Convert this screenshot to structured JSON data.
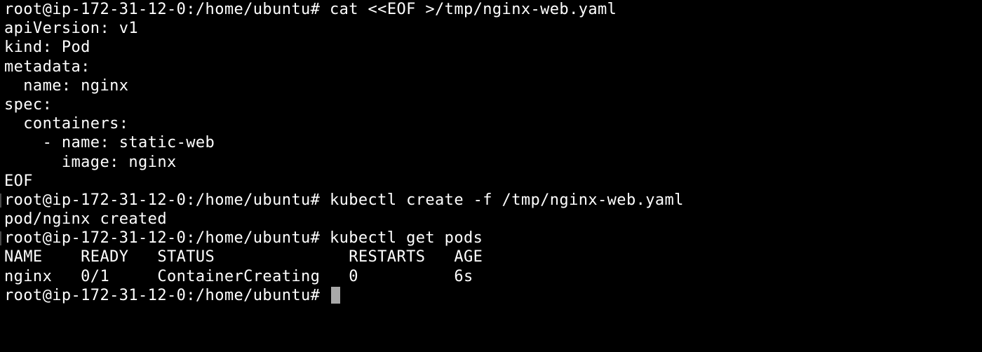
{
  "terminal": {
    "prompt": "root@ip-172-31-12-0:/home/ubuntu#",
    "lines": [
      {
        "prompt": "root@ip-172-31-12-0:/home/ubuntu#",
        "text": " cat <<EOF >/tmp/nginx-web.yaml"
      },
      {
        "prompt": "",
        "text": "apiVersion: v1"
      },
      {
        "prompt": "",
        "text": "kind: Pod"
      },
      {
        "prompt": "",
        "text": "metadata:"
      },
      {
        "prompt": "",
        "text": "  name: nginx"
      },
      {
        "prompt": "",
        "text": "spec:"
      },
      {
        "prompt": "",
        "text": "  containers:"
      },
      {
        "prompt": "",
        "text": "    - name: static-web"
      },
      {
        "prompt": "",
        "text": "      image: nginx"
      },
      {
        "prompt": "",
        "text": "EOF"
      },
      {
        "prompt": "root@ip-172-31-12-0:/home/ubuntu#",
        "text": " kubectl create -f /tmp/nginx-web.yaml"
      },
      {
        "prompt": "",
        "text": "pod/nginx created"
      },
      {
        "prompt": "root@ip-172-31-12-0:/home/ubuntu#",
        "text": " kubectl get pods"
      },
      {
        "prompt": "",
        "text": "NAME    READY   STATUS              RESTARTS   AGE"
      },
      {
        "prompt": "",
        "text": "nginx   0/1     ContainerCreating   0          6s"
      },
      {
        "prompt": "root@ip-172-31-12-0:/home/ubuntu#",
        "text": " "
      }
    ],
    "colors": {
      "background": "#000000",
      "foreground": "#ffffff",
      "cursor": "#a8a8a8"
    }
  }
}
